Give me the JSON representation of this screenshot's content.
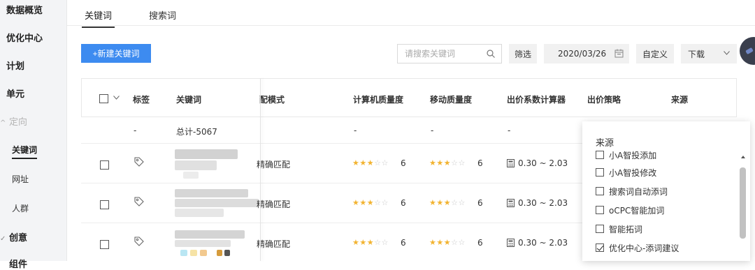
{
  "sidebar": {
    "items": [
      {
        "label": "数据概览"
      },
      {
        "label": "优化中心"
      },
      {
        "label": "计划"
      },
      {
        "label": "单元"
      },
      {
        "label": "定向"
      },
      {
        "label": "创意"
      },
      {
        "label": "组件"
      }
    ],
    "sub_items": [
      {
        "label": "关键词"
      },
      {
        "label": "网址"
      },
      {
        "label": "人群"
      }
    ]
  },
  "tabs": [
    {
      "label": "关键词"
    },
    {
      "label": "搜索词"
    }
  ],
  "toolbar": {
    "new_keyword": "+新建关键词",
    "search_placeholder": "请搜索关键词",
    "filter": "筛选",
    "date": "2020/03/26",
    "custom": "自定义",
    "download": "下载"
  },
  "table": {
    "headers": {
      "tag": "标签",
      "keyword": "关键词",
      "match": "配模式",
      "pc_quality": "计算机质量度",
      "mobile_quality": "移动质量度",
      "bid_calc": "出价系数计算器",
      "bid_strategy": "出价策略",
      "source": "来源"
    },
    "total_row": {
      "tag": "-",
      "keyword": "总计-5067",
      "pc_quality": "-",
      "mobile_quality": "-",
      "bid_calc": "-"
    },
    "rows": [
      {
        "match": "精确匹配",
        "pc_stars": 3,
        "pc_score": "6",
        "mobile_stars": 3,
        "mobile_score": "6",
        "bid_range": "0.30 ~ 2.03"
      },
      {
        "match": "精确匹配",
        "pc_stars": 3,
        "pc_score": "6",
        "mobile_stars": 3,
        "mobile_score": "6",
        "bid_range": "0.30 ~ 2.03"
      },
      {
        "match": "精确匹配",
        "pc_stars": 3,
        "pc_score": "6",
        "mobile_stars": 3,
        "mobile_score": "6",
        "bid_range": "0.30 ~ 2.03"
      }
    ]
  },
  "source_panel": {
    "title": "来源",
    "options": [
      {
        "label": "小A智投添加",
        "checked": false
      },
      {
        "label": "小A智投修改",
        "checked": false
      },
      {
        "label": "搜索词自动添词",
        "checked": false
      },
      {
        "label": "oCPC智能加词",
        "checked": false
      },
      {
        "label": "智能拓词",
        "checked": false
      },
      {
        "label": "优化中心-添词建议",
        "checked": true
      }
    ]
  },
  "colors": {
    "primary": "#3d8bf0",
    "star_on": "#f2b330",
    "star_off": "#c9c9c9"
  }
}
